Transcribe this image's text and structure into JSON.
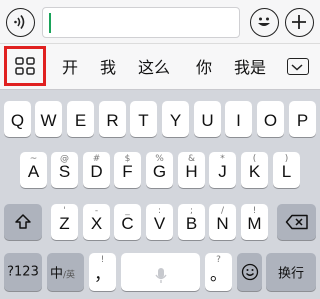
{
  "toolbar": {
    "voice_icon": "voice-icon",
    "emoji_icon": "emoji-icon",
    "plus_icon": "plus-icon"
  },
  "candidates": {
    "menu_icon": "grid-menu-icon",
    "words": [
      "开",
      "我",
      "这么",
      "你",
      "我是"
    ],
    "collapse_icon": "keyboard-collapse-icon",
    "menu_highlight_color": "#e02020"
  },
  "keyboard": {
    "row1": [
      "Q",
      "W",
      "E",
      "R",
      "T",
      "Y",
      "U",
      "I",
      "O",
      "P"
    ],
    "row2": [
      {
        "k": "A",
        "s": "~"
      },
      {
        "k": "S",
        "s": "@"
      },
      {
        "k": "D",
        "s": "#"
      },
      {
        "k": "F",
        "s": "$"
      },
      {
        "k": "G",
        "s": "%"
      },
      {
        "k": "H",
        "s": "&"
      },
      {
        "k": "J",
        "s": "*"
      },
      {
        "k": "K",
        "s": "("
      },
      {
        "k": "L",
        "s": ")"
      }
    ],
    "row3": [
      {
        "k": "Z",
        "s": "'"
      },
      {
        "k": "X",
        "s": "-"
      },
      {
        "k": "C",
        "s": "_"
      },
      {
        "k": "V",
        "s": ":"
      },
      {
        "k": "B",
        "s": ";"
      },
      {
        "k": "N",
        "s": "/"
      },
      {
        "k": "M",
        "s": "!"
      }
    ],
    "numbers_key": "?123",
    "lang_key_main": "中",
    "lang_key_sub": "/英",
    "comma_key": "，",
    "comma_sub": "!",
    "period_key": "。",
    "period_sub": "?",
    "return_key": "换行"
  }
}
